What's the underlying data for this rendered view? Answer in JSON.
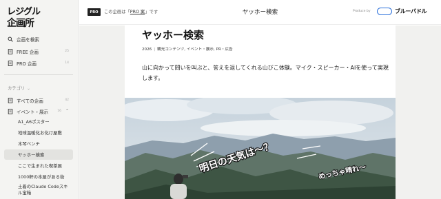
{
  "brand": {
    "logo_text": "レジグル企画所"
  },
  "sidebar": {
    "main_items": [
      {
        "label": "企画を検索",
        "icon": "search-icon"
      },
      {
        "label": "FREE 企画",
        "icon": "document-icon",
        "count": "25"
      },
      {
        "label": "PRO 企画",
        "icon": "document-icon",
        "count": "14"
      }
    ],
    "category_label": "カテゴリ",
    "categories": [
      {
        "label": "すべての企画",
        "count": "42"
      },
      {
        "label": "イベント・展示",
        "count": "16"
      }
    ],
    "sub_items": [
      "A1_A6ポスター",
      "地球温暖化お化け屋敷",
      "木琴ベンチ",
      "ヤッホー検索",
      "ここで生まれた喫茶展",
      "1000軒の本屋がある街",
      "土着のClaude Codeスキル宝箱"
    ],
    "active_sub_item": 3
  },
  "header": {
    "badge": "PRO",
    "note_prefix": "この企画は「",
    "note_link": "PRO 案",
    "note_suffix": "」です",
    "title": "ヤッホー検索",
    "produced_by": "Produce by",
    "brand_name": "ブルーバドル"
  },
  "article": {
    "title": "ヤッホー検索",
    "year": "2026",
    "tags": "観光コンテンツ, イベント・展示, PR・広告",
    "description": "山に向かって問いを叫ぶと、答えを返してくれる山びこ体験。マイク・スピーカー・AIを使って実現します。",
    "hero": {
      "caption_1": "明日の天気は〜？",
      "caption_2": "めっちゃ晴れ〜"
    }
  },
  "colors": {
    "accent": "#2a6fdb",
    "sidebar_bg": "#f4f4f2",
    "active_bg": "#e3e3e0"
  }
}
